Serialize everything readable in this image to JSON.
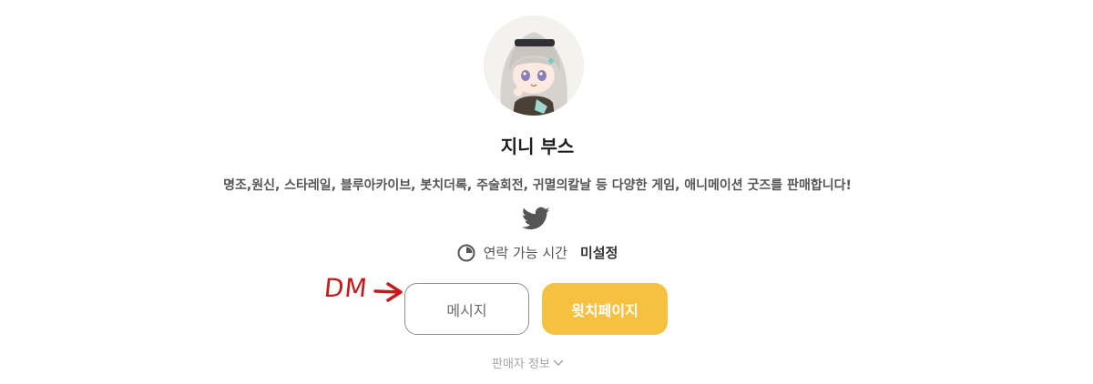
{
  "profile": {
    "name": "지니 부스",
    "description": "명조,원신, 스타레일, 블루아카이브, 봇치더록, 주술회전, 귀멸의칼날 등 다양한 게임, 애니메이션 굿즈를 판매합니다!",
    "social_icon": "twitter-icon"
  },
  "contact": {
    "label": "연락 가능 시간",
    "value": "미설정",
    "icon": "clock-icon"
  },
  "annotation": {
    "text": "DM",
    "color": "#c81a1a"
  },
  "buttons": {
    "message_label": "메시지",
    "watch_page_label": "윗치페이지"
  },
  "seller_info": {
    "label": "판매자 정보"
  },
  "colors": {
    "accent": "#f6c041",
    "twitter": "#555555"
  }
}
